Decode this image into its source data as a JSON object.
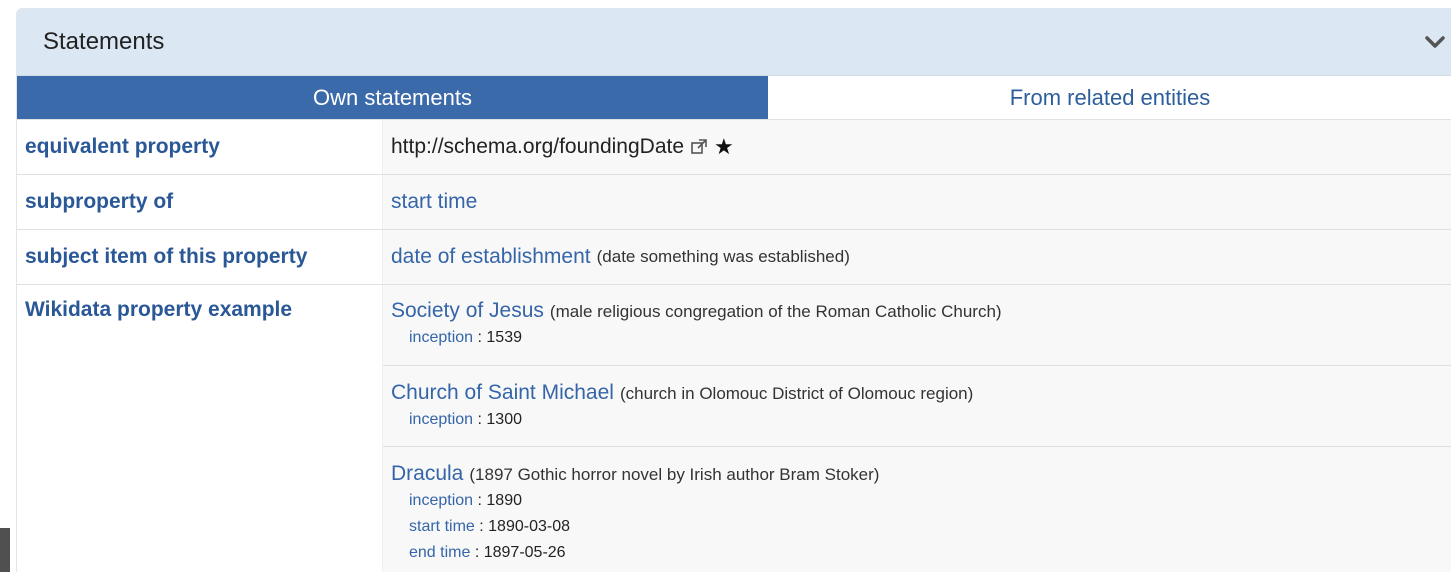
{
  "panel": {
    "title": "Statements"
  },
  "tabs": {
    "own": "Own statements",
    "related": "From related entities"
  },
  "rows": [
    {
      "property": "equivalent property",
      "value": "http://schema.org/foundingDate"
    },
    {
      "property": "subproperty of",
      "value": "start time"
    },
    {
      "property": "subject item of this property",
      "value": "date of establishment",
      "description": "(date something was established)"
    }
  ],
  "examples": {
    "property": "Wikidata property example",
    "items": [
      {
        "label": "Society of Jesus",
        "description": "(male religious congregation of the Roman Catholic Church)",
        "qualifiers": [
          {
            "key": "inception",
            "sep": " : ",
            "value": "1539"
          }
        ]
      },
      {
        "label": "Church of Saint Michael",
        "description": "(church in Olomouc District of Olomouc region)",
        "qualifiers": [
          {
            "key": "inception",
            "sep": " : ",
            "value": "1300"
          }
        ]
      },
      {
        "label": "Dracula",
        "description": "(1897 Gothic horror novel by Irish author Bram Stoker)",
        "qualifiers": [
          {
            "key": "inception",
            "sep": " : ",
            "value": "1890"
          },
          {
            "key": "start time",
            "sep": " : ",
            "value": "1890-03-08"
          },
          {
            "key": "end time",
            "sep": " : ",
            "value": "1897-05-26"
          }
        ]
      }
    ]
  },
  "icons": {
    "external": "external-link-icon",
    "star": "★",
    "collapse": "chevron-down-icon"
  },
  "colors": {
    "header_bg": "#dbe8f4",
    "active_tab": "#3b6aaa",
    "link": "#3565a8",
    "property": "#2a5897"
  }
}
